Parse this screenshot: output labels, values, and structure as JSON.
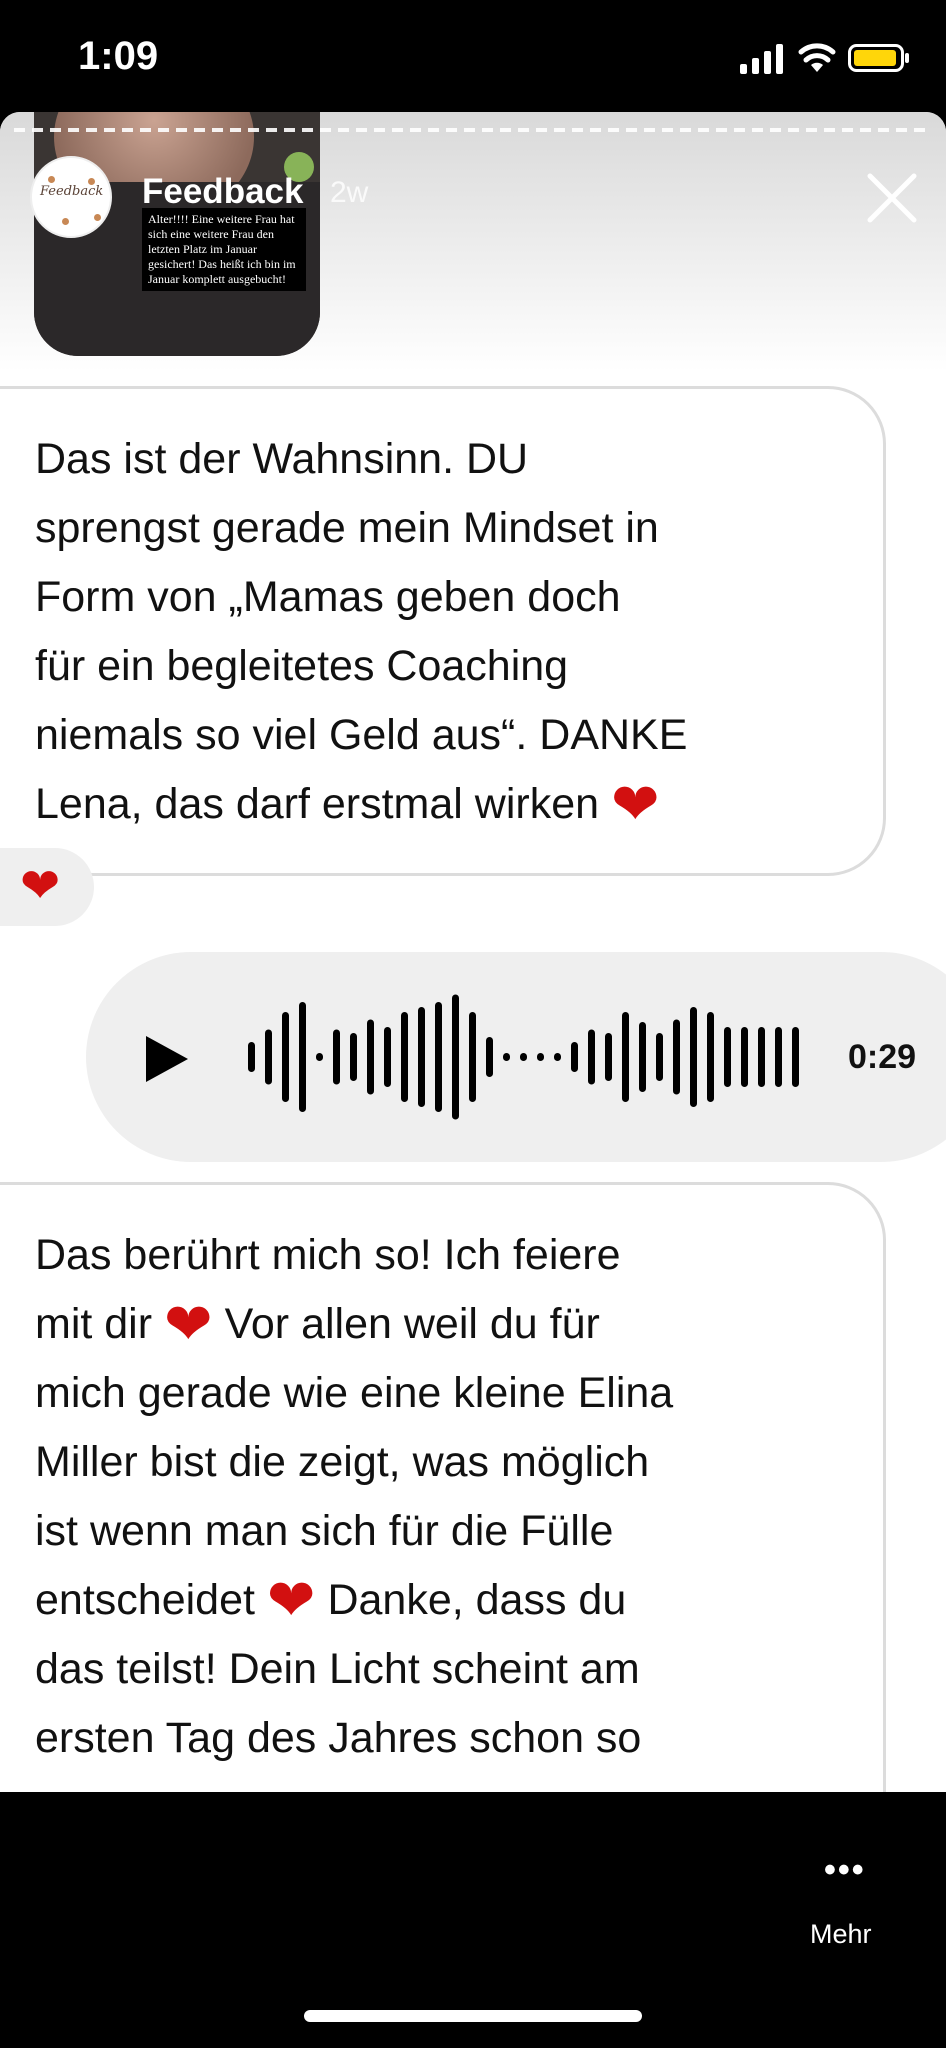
{
  "status_bar": {
    "time": "1:09"
  },
  "story_header": {
    "account_name": "Feedback",
    "avatar_text": "Feedback",
    "age": "2w",
    "reply_thumbnail_caption": "Alter!!!! Eine weitere Frau hat sich eine weitere Frau den letzten Platz im Januar gesichert! Das heißt ich bin im Januar komplett ausgebucht!"
  },
  "messages": [
    {
      "lines": [
        "Das ist der Wahnsinn. DU",
        "sprengst gerade mein Mindset in",
        "Form von „Mamas geben doch",
        "für ein begleitetes Coaching",
        "niemals so viel Geld aus“. DANKE",
        "Lena, das darf erstmal wirken"
      ],
      "reaction": "heart"
    },
    {
      "type": "voice",
      "duration": "0:29"
    },
    {
      "lines": [
        "Das berührt mich so! Ich feiere",
        "mit dir",
        "Vor allen weil du für",
        "mich gerade wie eine kleine Elina",
        "Miller bist die zeigt, was möglich",
        "ist wenn man sich für die Fülle",
        "entscheidet",
        "Danke, dass du",
        "das teilst! Dein Licht scheint am",
        "ersten Tag des Jahres schon so"
      ]
    }
  ],
  "footer": {
    "more_label": "Mehr"
  },
  "colors": {
    "heart": "#d21010",
    "bubble_border": "#dcdcdc",
    "voice_background": "#efefef"
  }
}
